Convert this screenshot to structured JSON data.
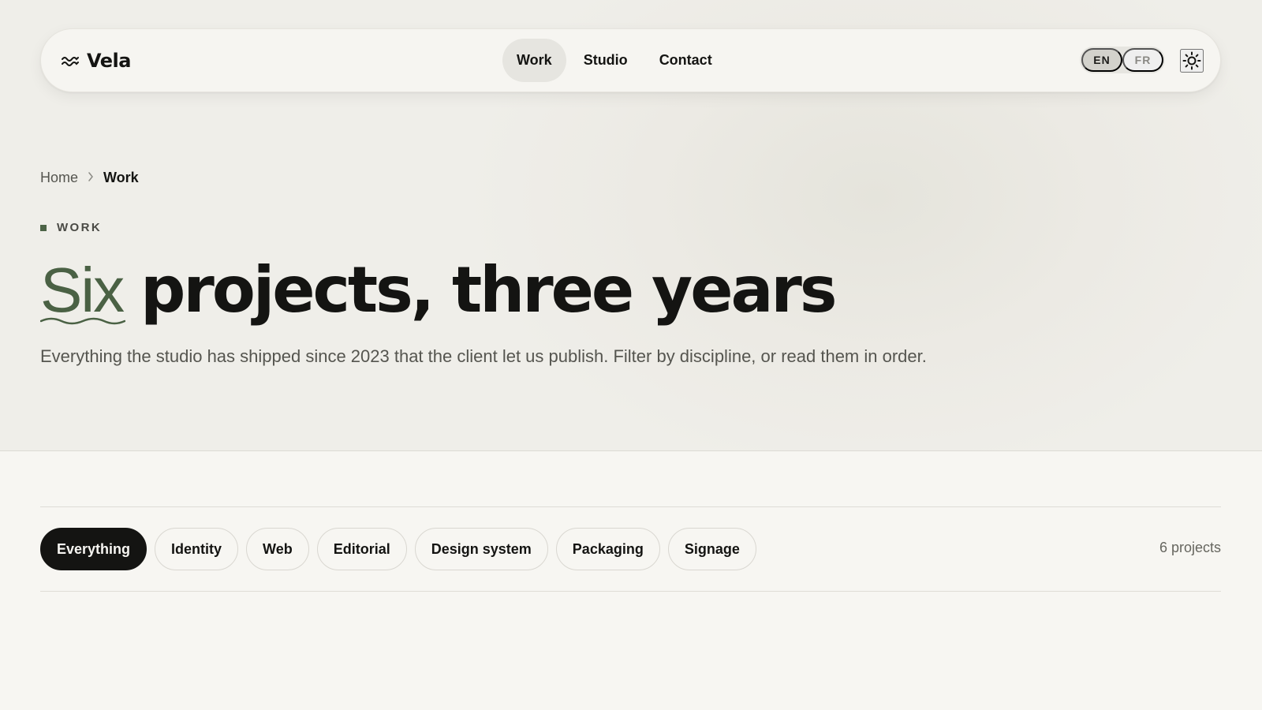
{
  "nav": {
    "brand": "Vela",
    "links": [
      {
        "label": "Work",
        "active": true
      },
      {
        "label": "Studio",
        "active": false
      },
      {
        "label": "Contact",
        "active": false
      }
    ],
    "languages": [
      {
        "label": "EN",
        "active": true
      },
      {
        "label": "FR",
        "active": false
      }
    ],
    "theme_icon": "sun-icon"
  },
  "breadcrumb": {
    "home": "Home",
    "separator_icon": "chevron-right-icon",
    "current": "Work"
  },
  "hero": {
    "eyebrow": "WORK",
    "headline_accent": "Six",
    "headline_rest": "projects, three years",
    "lede": "Everything the studio has shipped since 2023 that the client let us publish. Filter by discipline, or read them in order."
  },
  "filters": {
    "chips": [
      {
        "label": "Everything",
        "active": true
      },
      {
        "label": "Identity",
        "active": false
      },
      {
        "label": "Web",
        "active": false
      },
      {
        "label": "Editorial",
        "active": false
      },
      {
        "label": "Design system",
        "active": false
      },
      {
        "label": "Packaging",
        "active": false
      },
      {
        "label": "Signage",
        "active": false
      }
    ],
    "count": "6 projects"
  },
  "colors": {
    "accent": "#4a6144",
    "ink": "#141412",
    "background": "#f7f6f2"
  }
}
